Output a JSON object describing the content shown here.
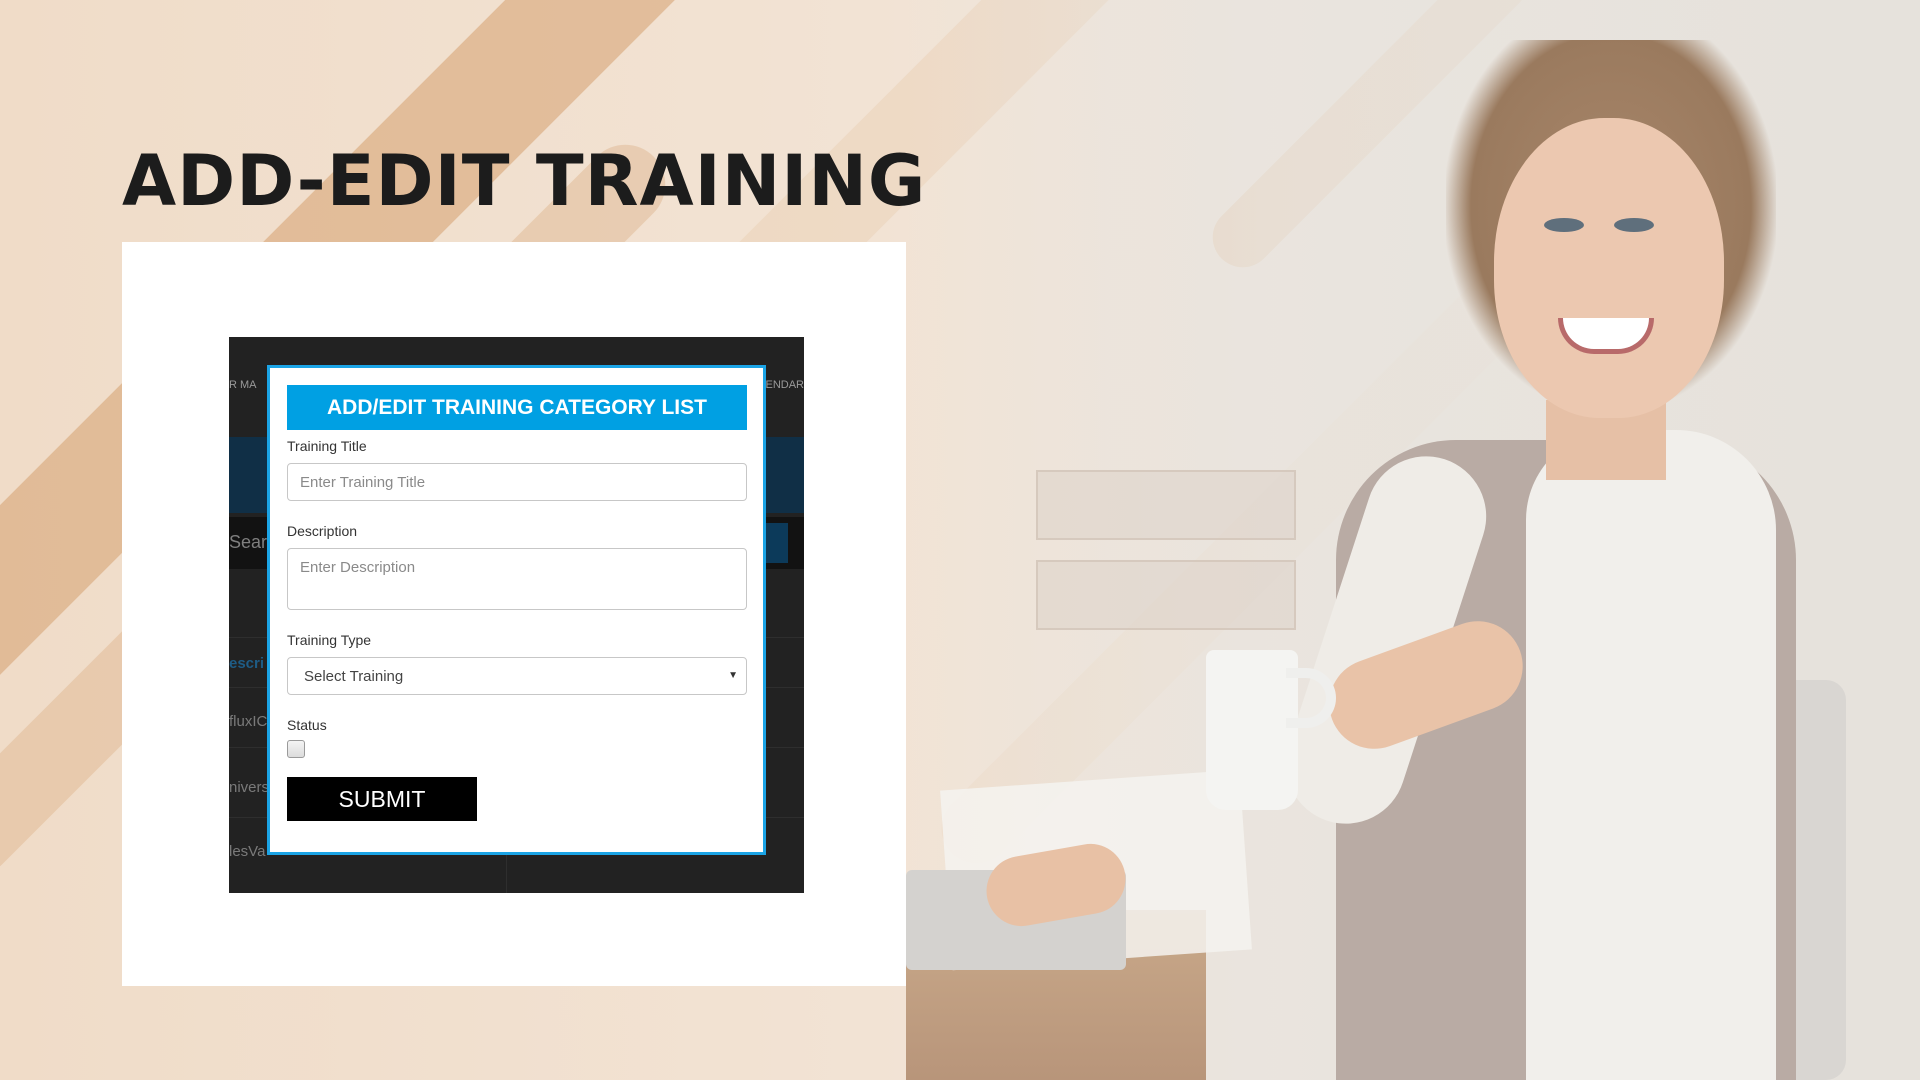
{
  "page": {
    "title": "ADD-EDIT TRAINING"
  },
  "app_background": {
    "nav_left": "R MA",
    "nav_right": "ENDAR",
    "search_label": "Sear",
    "table_header": "escri",
    "rows": [
      "fluxIC",
      "nivers",
      "lesVa"
    ]
  },
  "modal": {
    "header": "ADD/EDIT TRAINING CATEGORY LIST",
    "training_title_label": "Training Title",
    "training_title_placeholder": "Enter Training Title",
    "description_label": "Description",
    "description_placeholder": "Enter Description",
    "training_type_label": "Training Type",
    "training_type_selected": "Select Training",
    "status_label": "Status",
    "status_checked": false,
    "submit_label": "SUBMIT"
  },
  "colors": {
    "modal_accent": "#00a0e3",
    "modal_border": "#1ba4e6",
    "submit_bg": "#000000",
    "title_text": "#1c1c1c"
  },
  "icons": {
    "select_arrow": "chevron-down-icon"
  }
}
